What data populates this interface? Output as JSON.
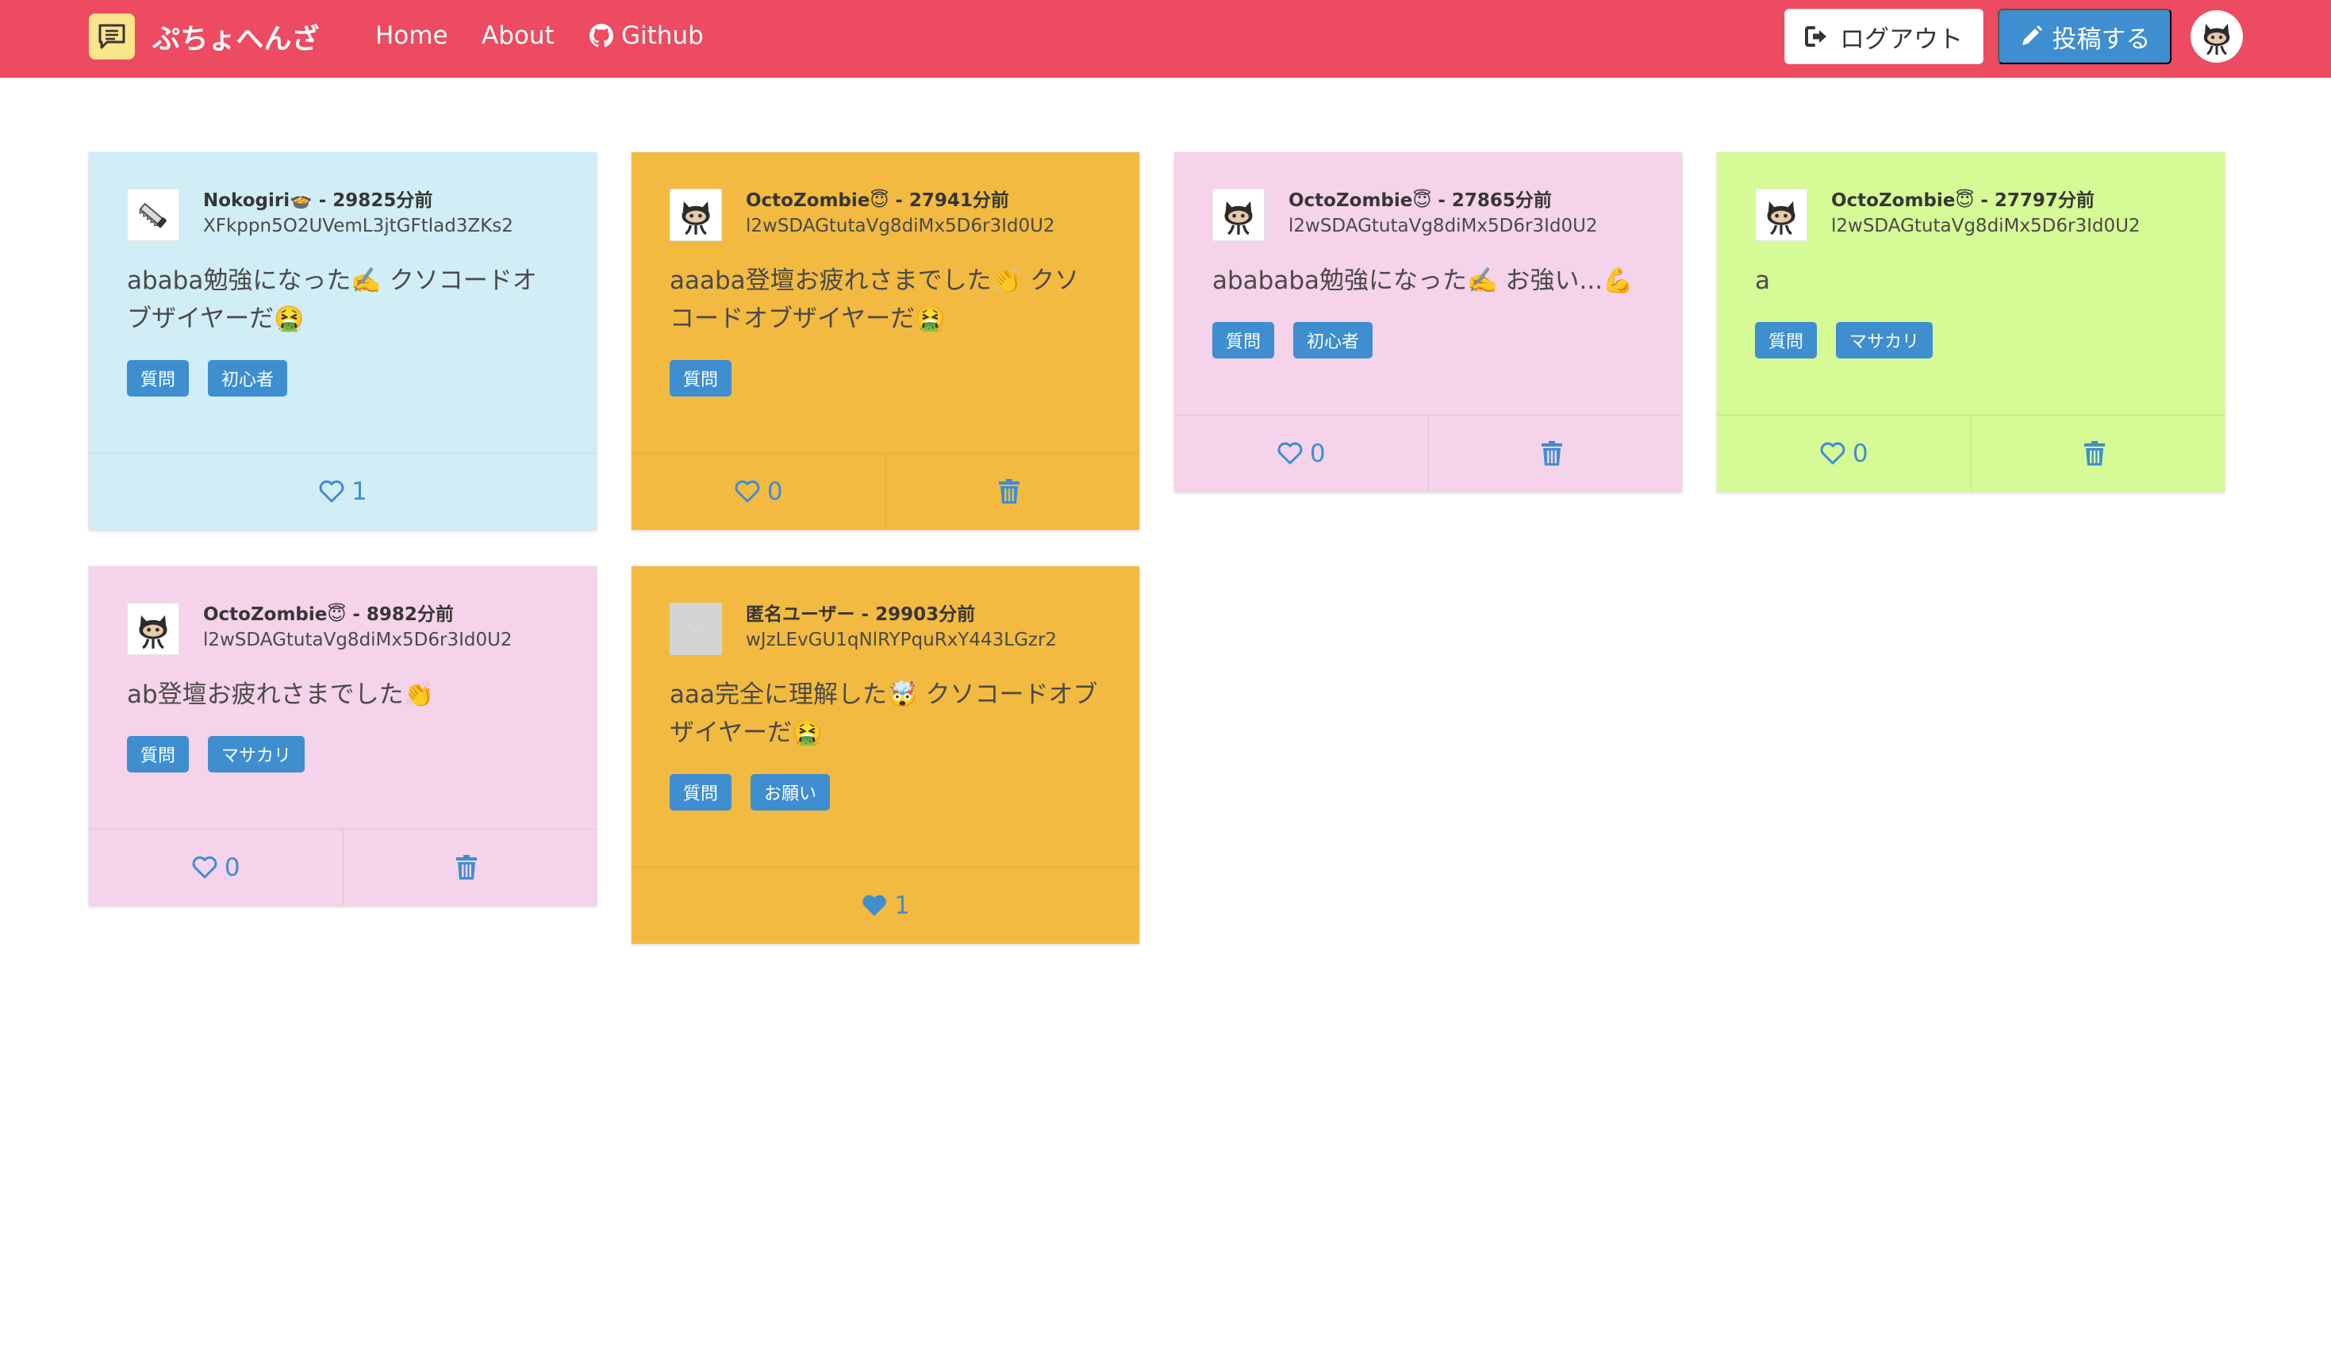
{
  "navbar": {
    "brand": "ぷちょへんざ",
    "links": {
      "home": "Home",
      "about": "About",
      "github": "Github"
    },
    "logout_label": "ログアウト",
    "post_label": "投稿する",
    "icons": {
      "brand": "chat-icon",
      "github": "github-icon",
      "logout": "logout-icon",
      "post": "pencil-icon",
      "avatar": "octocat-avatar"
    }
  },
  "colors": {
    "navbar": "#ec4b61",
    "primary": "#3e8ed0",
    "card_blue": "#d1edf6",
    "card_orange": "#f2ba40",
    "card_pink": "#f5d3ea",
    "card_green": "#d6fa96"
  },
  "posts": [
    {
      "title": "Nokogiri🍲 - 29825分前",
      "user_id": "XFkppn5O2UVemL3jtGFtlad3ZKs2",
      "body": "ababa勉強になった✍️ クソコードオブザイヤーだ🤮",
      "tags": [
        "質問",
        "初心者"
      ],
      "likes": "1",
      "liked": false,
      "deletable": false,
      "color": "blue",
      "avatar": "saw-icon"
    },
    {
      "title": "OctoZombie😇 - 27941分前",
      "user_id": "l2wSDAGtutaVg8diMx5D6r3Id0U2",
      "body": "aaaba登壇お疲れさまでした👏 クソコードオブザイヤーだ🤮",
      "tags": [
        "質問"
      ],
      "likes": "0",
      "liked": false,
      "deletable": true,
      "color": "orange",
      "avatar": "octocat-icon"
    },
    {
      "title": "OctoZombie😇 - 27865分前",
      "user_id": "l2wSDAGtutaVg8diMx5D6r3Id0U2",
      "body": "abababa勉強になった✍️ お強い...💪",
      "tags": [
        "質問",
        "初心者"
      ],
      "likes": "0",
      "liked": false,
      "deletable": true,
      "color": "pink",
      "avatar": "octocat-icon"
    },
    {
      "title": "OctoZombie😇 - 27797分前",
      "user_id": "l2wSDAGtutaVg8diMx5D6r3Id0U2",
      "body": "a",
      "tags": [
        "質問",
        "マサカリ"
      ],
      "likes": "0",
      "liked": false,
      "deletable": true,
      "color": "green",
      "avatar": "octocat-icon"
    },
    {
      "title": "OctoZombie😇 - 8982分前",
      "user_id": "l2wSDAGtutaVg8diMx5D6r3Id0U2",
      "body": "ab登壇お疲れさまでした👏",
      "tags": [
        "質問",
        "マサカリ"
      ],
      "likes": "0",
      "liked": false,
      "deletable": true,
      "color": "pink",
      "avatar": "octocat-icon"
    },
    {
      "title": "匿名ユーザー - 29903分前",
      "user_id": "wJzLEvGU1qNlRYPquRxY443LGzr2",
      "body": "aaa完全に理解した🤯 クソコードオブザイヤーだ🤮",
      "tags": [
        "質問",
        "お願い"
      ],
      "likes": "1",
      "liked": true,
      "deletable": false,
      "color": "orange",
      "avatar": "anonymous-avatar"
    }
  ]
}
